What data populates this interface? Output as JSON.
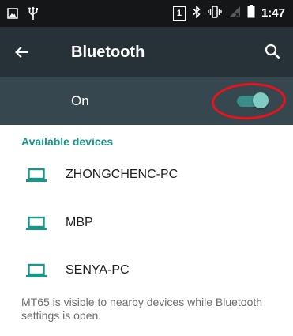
{
  "status_bar": {
    "sim_slot": "1",
    "time": "1:47",
    "icons": [
      "image-notification-icon",
      "usb-icon",
      "bluetooth-icon",
      "vibrate-icon",
      "no-signal-icon",
      "battery-icon"
    ]
  },
  "toolbar": {
    "title": "Bluetooth",
    "back_icon": "arrow-back-icon",
    "search_icon": "search-icon"
  },
  "master_switch": {
    "label": "On",
    "state": "on",
    "accent": "#80cbc4"
  },
  "devices": {
    "header": "Available devices",
    "items": [
      {
        "name": "ZHONGCHENC-PC",
        "icon": "laptop-icon"
      },
      {
        "name": "MBP",
        "icon": "laptop-icon"
      },
      {
        "name": "SENYA-PC",
        "icon": "laptop-icon"
      }
    ]
  },
  "footer": {
    "visibility_note": "MT65 is visible to nearby devices while Bluetooth settings is open."
  },
  "colors": {
    "status_bar": "#141618",
    "toolbar": "#263238",
    "switch_bar": "#37474f",
    "accent": "#1a9688",
    "highlight": "#e8131b"
  }
}
